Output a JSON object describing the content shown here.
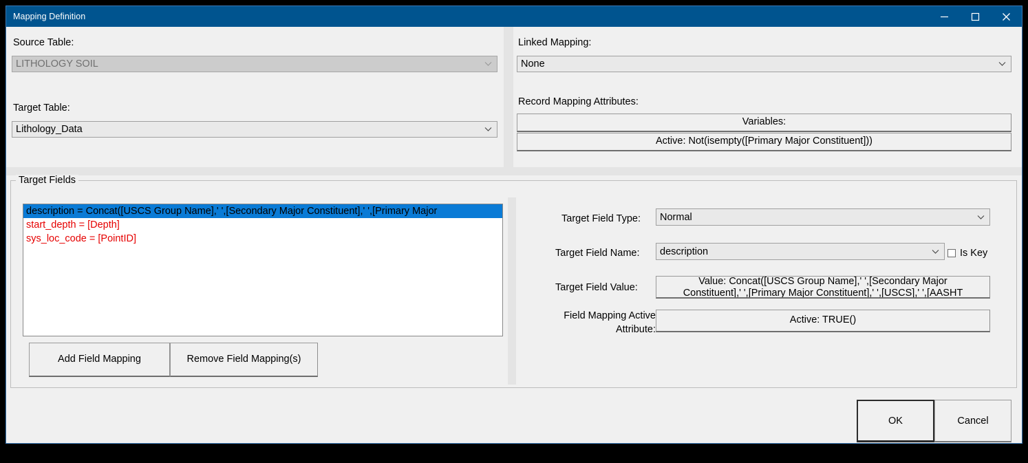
{
  "window": {
    "title": "Mapping Definition",
    "accent_color": "#00548f",
    "controls": {
      "minimize": "minimize-icon",
      "maximize": "maximize-icon",
      "close": "close-icon"
    }
  },
  "left_top": {
    "source_table_label": "Source Table:",
    "source_table_value": "LITHOLOGY SOIL",
    "target_table_label": "Target Table:",
    "target_table_value": "Lithology_Data"
  },
  "right_top": {
    "linked_mapping_label": "Linked Mapping:",
    "linked_mapping_value": "None",
    "record_mapping_attributes_label": "Record Mapping Attributes:",
    "variables_button": "Variables:",
    "active_button": "Active: Not(isempty([Primary Major Constituent]))"
  },
  "target_fields": {
    "group_title": "Target Fields",
    "items": [
      {
        "text": "description = Concat([USCS Group Name],' ',[Secondary Major Constituent],' ',[Primary Major",
        "selected": true,
        "color": "#000000"
      },
      {
        "text": "start_depth = [Depth]",
        "selected": false,
        "color": "#e60000"
      },
      {
        "text": "sys_loc_code = [PointID]",
        "selected": false,
        "color": "#e60000"
      }
    ],
    "selection_color": "#0a7bd6",
    "add_button": "Add Field Mapping",
    "remove_button": "Remove Field Mapping(s)"
  },
  "field_detail": {
    "target_field_type_label": "Target Field Type:",
    "target_field_type_value": "Normal",
    "target_field_name_label": "Target Field Name:",
    "target_field_name_value": "description",
    "is_key_label": "Is Key",
    "is_key_checked": false,
    "target_field_value_label": "Target Field Value:",
    "target_field_value_text": "Value: Concat([USCS Group Name],' ',[Secondary Major\nConstituent],' ',[Primary Major Constituent],' ',[USCS],' ',[AASHT",
    "field_mapping_active_attribute_label": "Field Mapping Active\nAttribute:",
    "field_mapping_active_attribute_value": "Active: TRUE()"
  },
  "footer": {
    "ok_button": "OK",
    "cancel_button": "Cancel"
  }
}
